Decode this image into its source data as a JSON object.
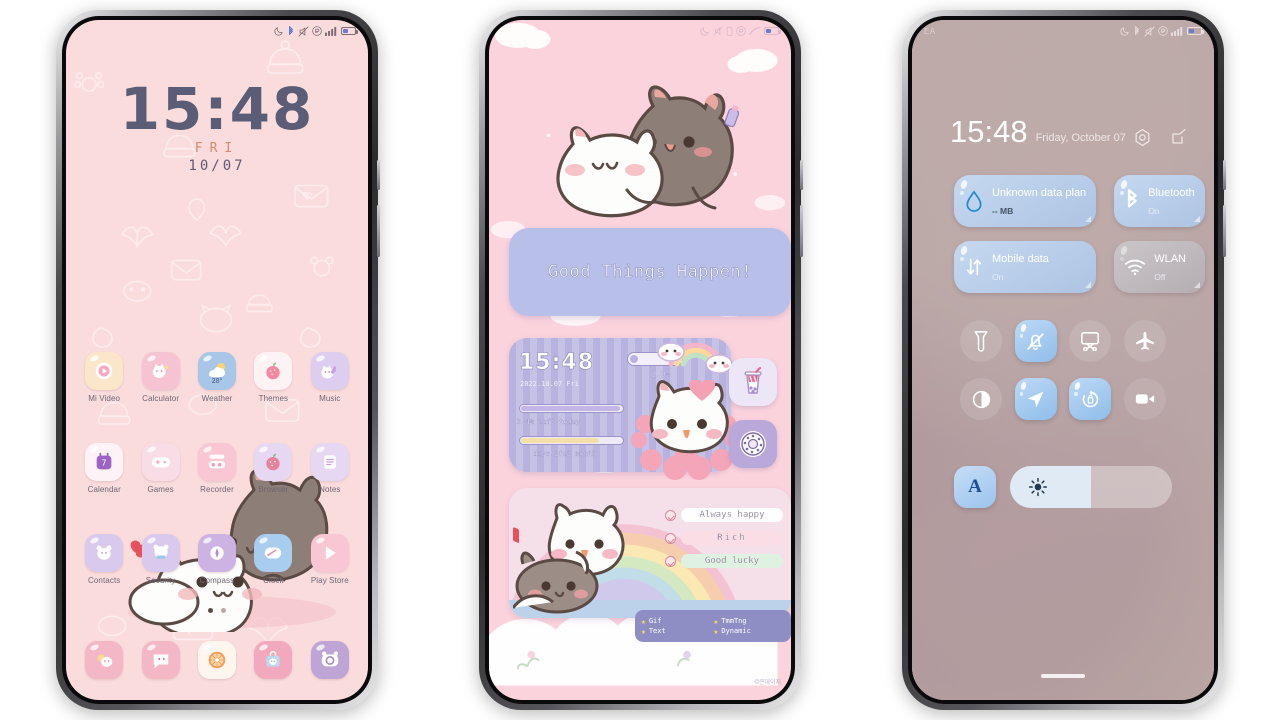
{
  "phone1": {
    "name": "home-screen",
    "statusbar": {
      "icons": [
        "dnd-moon-icon",
        "bluetooth-icon",
        "mute-icon",
        "roaming-icon",
        "signal-icon",
        "battery-icon"
      ]
    },
    "clock": {
      "time": "15:48",
      "weekday": "FRI",
      "date": "10/07"
    },
    "rows": [
      [
        {
          "label": "Mi Video",
          "icon": "mi-video-icon",
          "bg": "#fce6c9",
          "fg": "#f48aa5"
        },
        {
          "label": "Calculator",
          "icon": "calculator-icon",
          "bg": "#f6c3d2",
          "fg": "#ffffff"
        },
        {
          "label": "Weather",
          "icon": "weather-icon",
          "bg": "#a7c6e8",
          "fg": "#ffffff",
          "badge": "28°"
        },
        {
          "label": "Themes",
          "icon": "themes-icon",
          "bg": "#fdf2f4",
          "fg": "#f08a9e"
        },
        {
          "label": "Music",
          "icon": "music-icon",
          "bg": "#ddcdee",
          "fg": "#ffffff"
        }
      ],
      [
        {
          "label": "Calendar",
          "icon": "calendar-icon",
          "bg": "#fdf2f6",
          "fg": "#a36fc2",
          "badge": "7"
        },
        {
          "label": "Games",
          "icon": "games-icon",
          "bg": "#f8dde6",
          "fg": "#ffffff"
        },
        {
          "label": "Recorder",
          "icon": "recorder-icon",
          "bg": "#f9c7d3",
          "fg": "#ffffff"
        },
        {
          "label": "Browser",
          "icon": "browser-icon",
          "bg": "#e6d7f2",
          "fg": "#e8839f"
        },
        {
          "label": "Notes",
          "icon": "notes-icon",
          "bg": "#e6d7f2",
          "fg": "#ffffff"
        }
      ],
      [
        {
          "label": "Contacts",
          "icon": "contacts-icon",
          "bg": "#d9c9ec",
          "fg": "#ffffff"
        },
        {
          "label": "Security",
          "icon": "security-icon",
          "bg": "#d9c9ec",
          "fg": "#ffffff"
        },
        {
          "label": "Compass",
          "icon": "compass-icon",
          "bg": "#cdb3e3",
          "fg": "#ffffff"
        },
        {
          "label": "Clock",
          "icon": "clock-icon",
          "bg": "#a9cdee",
          "fg": "#ffffff"
        },
        {
          "label": "Play Store",
          "icon": "play-store-icon",
          "bg": "#f9c6d4",
          "fg": "#ffffff"
        }
      ]
    ],
    "dock": [
      {
        "label": "Gallery",
        "icon": "gallery-icon",
        "bg": "#f3b7c5"
      },
      {
        "label": "Messages",
        "icon": "messages-icon",
        "bg": "#f3b7c5"
      },
      {
        "label": "Chrome",
        "icon": "chrome-icon",
        "bg": "#fdf6ef"
      },
      {
        "label": "Store",
        "icon": "store-icon",
        "bg": "#f3a9bd"
      },
      {
        "label": "Camera",
        "icon": "camera-icon",
        "bg": "#bfa5d6"
      }
    ],
    "page_dots": {
      "count": 2,
      "active": 0
    }
  },
  "phone2": {
    "name": "widget-screen",
    "statusbar": {
      "icons": [
        "dnd-moon-icon",
        "mute-icon",
        "battery-saver-icon",
        "roaming-icon",
        "signal-icon",
        "battery-icon"
      ]
    },
    "quote_widget": {
      "text": "Good Things Happen!",
      "bg": "#b8bfe8"
    },
    "clock_widget": {
      "time": "15:48",
      "date": "2022.10.07 Fri",
      "battery_pct": "2.9%",
      "bar1_label": "3.4% left today",
      "bar1_value": 96,
      "bar2_label": "days 1fet month",
      "bar2_value": 76,
      "bar1_color": "#c3b6e6",
      "bar2_color": "#f3e0a8"
    },
    "side_icons": [
      {
        "name": "boba-drink-icon",
        "bg": "#ece6f6"
      },
      {
        "name": "donut-settings-icon",
        "bg": "#b9a8da"
      }
    ],
    "wish_widget": {
      "items": [
        {
          "text": "Always happy",
          "bg": "#fefefe"
        },
        {
          "text": "Rich",
          "bg": "#fbdde5"
        },
        {
          "text": "Good lucky",
          "bg": "#dff2e2"
        }
      ]
    },
    "tag_bar": {
      "bg": "#8e8ec4",
      "tags": [
        "Gif",
        "TmmTng",
        "Text",
        "Dynamic"
      ]
    },
    "watermark": "©큰데이지"
  },
  "phone3": {
    "name": "control-center",
    "statusbar": {
      "carrier": "EA",
      "icons": [
        "dnd-moon-icon",
        "bluetooth-icon",
        "mute-icon",
        "roaming-icon",
        "signal-icon",
        "battery-icon"
      ]
    },
    "header": {
      "time": "15:48",
      "date": "Friday, October 07",
      "actions": [
        "settings-gear-icon",
        "edit-icon"
      ]
    },
    "tiles": [
      {
        "label": "Unknown data plan",
        "sub": "-- MB",
        "icon": "data-drop-icon",
        "state": "on"
      },
      {
        "label": "Bluetooth",
        "sub": "On",
        "icon": "bluetooth-icon",
        "state": "on"
      },
      {
        "label": "Mobile data",
        "sub": "On",
        "icon": "mobile-data-icon",
        "state": "on"
      },
      {
        "label": "WLAN",
        "sub": "Off",
        "icon": "wifi-icon",
        "state": "off"
      }
    ],
    "toggles": [
      {
        "name": "flashlight-icon",
        "state": "off"
      },
      {
        "name": "silent-mode-icon",
        "state": "on"
      },
      {
        "name": "screenshot-icon",
        "state": "off"
      },
      {
        "name": "airplane-mode-icon",
        "state": "off"
      },
      {
        "name": "dark-mode-icon",
        "state": "off"
      },
      {
        "name": "location-icon",
        "state": "on"
      },
      {
        "name": "auto-rotate-icon",
        "state": "on"
      },
      {
        "name": "screen-recorder-icon",
        "state": "dim"
      }
    ],
    "brightness": {
      "auto_label": "A",
      "value": 50,
      "icon": "brightness-sun-icon"
    }
  }
}
